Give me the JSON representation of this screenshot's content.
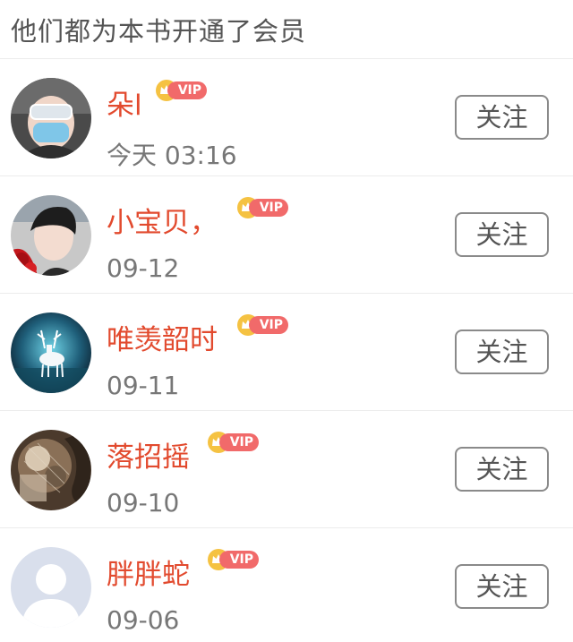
{
  "header": {
    "title": "他们都为本书开通了会员"
  },
  "members": [
    {
      "name": "朵l",
      "vip": "VIP",
      "date": "今天 03:16",
      "follow": "关注",
      "avatar": "avatar-mask-photo"
    },
    {
      "name": "小宝贝，",
      "vip": "VIP",
      "date": "09-12",
      "follow": "关注",
      "avatar": "avatar-portrait-photo"
    },
    {
      "name": "唯羡韶时",
      "vip": "VIP",
      "date": "09-11",
      "follow": "关注",
      "avatar": "avatar-deer-photo"
    },
    {
      "name": "落招摇",
      "vip": "VIP",
      "date": "09-10",
      "follow": "关注",
      "avatar": "avatar-art-photo"
    },
    {
      "name": "胖胖蛇",
      "vip": "VIP",
      "date": "09-06",
      "follow": "关注",
      "avatar": "avatar-default-silhouette"
    }
  ],
  "colors": {
    "name": "#e24a2e",
    "vip_pill": "#f16a6a",
    "crown": "#f5c242",
    "date": "#777777"
  }
}
